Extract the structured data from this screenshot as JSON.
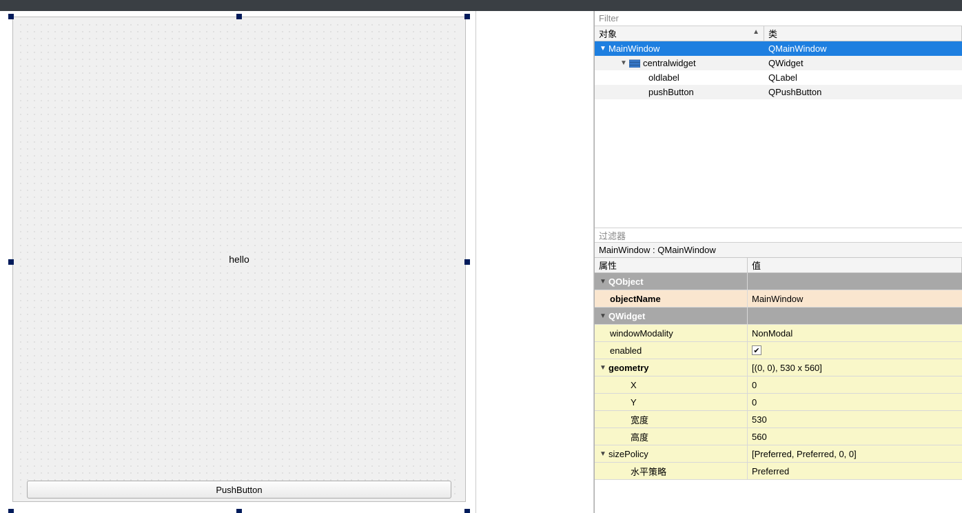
{
  "designer": {
    "label_text": "hello",
    "button_text": "PushButton"
  },
  "tree": {
    "filter_placeholder": "Filter",
    "header_object": "对象",
    "header_class": "类",
    "rows": [
      {
        "name": "MainWindow",
        "class": "QMainWindow"
      },
      {
        "name": "centralwidget",
        "class": "QWidget"
      },
      {
        "name": "oldlabel",
        "class": "QLabel"
      },
      {
        "name": "pushButton",
        "class": "QPushButton"
      }
    ]
  },
  "props": {
    "filter_placeholder": "过滤器",
    "title": "MainWindow : QMainWindow",
    "header_name": "属性",
    "header_value": "值",
    "groups": {
      "qobject": "QObject",
      "qwidget": "QWidget"
    },
    "rows": {
      "objectName_label": "objectName",
      "objectName_value": "MainWindow",
      "windowModality_label": "windowModality",
      "windowModality_value": "NonModal",
      "enabled_label": "enabled",
      "enabled_checked": "✔",
      "geometry_label": "geometry",
      "geometry_value": "[(0, 0), 530 x 560]",
      "x_label": "X",
      "x_value": "0",
      "y_label": "Y",
      "y_value": "0",
      "w_label": "宽度",
      "w_value": "530",
      "h_label": "高度",
      "h_value": "560",
      "sizePolicy_label": "sizePolicy",
      "sizePolicy_value": "[Preferred, Preferred, 0, 0]",
      "hpolicy_label": "水平策略",
      "hpolicy_value": "Preferred"
    }
  }
}
